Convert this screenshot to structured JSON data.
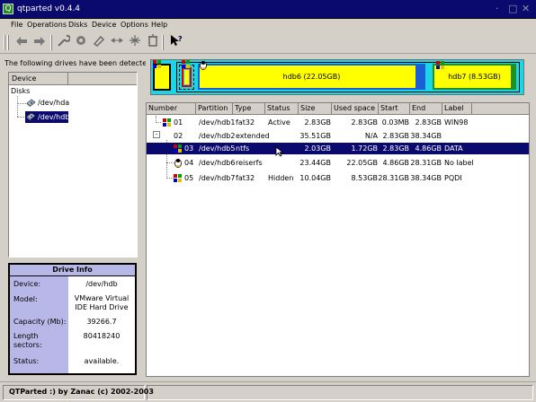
{
  "window": {
    "title": "qtparted v0.4.4",
    "controls": [
      "·",
      "□",
      "✕"
    ]
  },
  "menu": [
    "File",
    "Operations",
    "Disks",
    "Device",
    "Options",
    "Help"
  ],
  "toolbar": {
    "buttons": [
      "undo-icon",
      "redo-icon",
      "wrench-icon",
      "settings-icon",
      "eraser-icon",
      "move-icon",
      "split-icon",
      "trash-icon",
      "help-icon"
    ]
  },
  "drives": {
    "label": "The following drives have been detected:",
    "columns": [
      "Device",
      ""
    ],
    "root": "Disks",
    "items": [
      "/dev/hda",
      "/dev/hdb"
    ]
  },
  "drive_info": {
    "title": "Drive Info",
    "rows": [
      {
        "label": "Device:",
        "value": "/dev/hdb"
      },
      {
        "label": "Model:",
        "value": "VMware Virtual IDE Hard Drive"
      },
      {
        "label": "Capacity (Mb):",
        "value": "39266.7"
      },
      {
        "label": "Length sectors:",
        "value": "80418240"
      },
      {
        "label": "Status:",
        "value": "available."
      }
    ]
  },
  "disk_map": {
    "hdb6_label": "hdb6 (22.05GB)",
    "hdb7_label": "hdb7 (8.53GB)"
  },
  "partitions": {
    "columns": [
      "Number",
      "Partition",
      "Type",
      "Status",
      "Size",
      "Used space",
      "Start",
      "End",
      "Label"
    ],
    "rows": [
      {
        "number": "01",
        "partition": "/dev/hdb1",
        "type": "fat32",
        "status": "Active",
        "size": "2.83GB",
        "used": "2.83GB",
        "start": "0.03MB",
        "end": "2.83GB",
        "label": "WIN98"
      },
      {
        "number": "02",
        "partition": "/dev/hdb2",
        "type": "extended",
        "status": "",
        "size": "35.51GB",
        "used": "N/A",
        "start": "2.83GB",
        "end": "38.34GB",
        "label": ""
      },
      {
        "number": "03",
        "partition": "/dev/hdb5",
        "type": "ntfs",
        "status": "",
        "size": "2.03GB",
        "used": "1.72GB",
        "start": "2.83GB",
        "end": "4.86GB",
        "label": "DATA"
      },
      {
        "number": "04",
        "partition": "/dev/hdb6",
        "type": "reiserfs",
        "status": "",
        "size": "23.44GB",
        "used": "22.05GB",
        "start": "4.86GB",
        "end": "28.31GB",
        "label": "No label"
      },
      {
        "number": "05",
        "partition": "/dev/hdb7",
        "type": "fat32",
        "status": "Hidden",
        "size": "10.04GB",
        "used": "8.53GB",
        "start": "28.31GB",
        "end": "38.34GB",
        "label": "PQDI"
      }
    ]
  },
  "status": {
    "text": "QTParted :)   by Zanac (c) 2002-2003"
  },
  "colors": {
    "titlebar": "#0a0a6e",
    "selection": "#0a0a6e",
    "info_label_bg": "#b8b8e8",
    "disk_map_bg": "#1ad6e6",
    "partition_fill": "#ffff00"
  }
}
